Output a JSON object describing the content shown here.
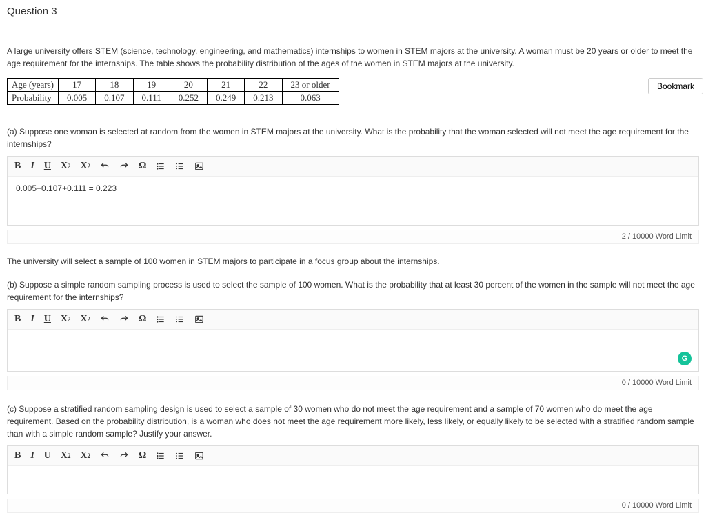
{
  "question_title": "Question 3",
  "intro": "A large university offers STEM (science, technology, engineering, and mathematics) internships to women in STEM majors at the university. A woman must be 20 years or older to meet the age requirement for the internships. The table shows the probability distribution of the ages of the women in STEM majors at the university.",
  "table": {
    "row1_label": "Age (years)",
    "row2_label": "Probability",
    "ages": [
      "17",
      "18",
      "19",
      "20",
      "21",
      "22",
      "23 or older"
    ],
    "probs": [
      "0.005",
      "0.107",
      "0.111",
      "0.252",
      "0.249",
      "0.213",
      "0.063"
    ]
  },
  "bookmark_label": "Bookmark",
  "part_a": "(a) Suppose one woman is selected at random from the women in STEM majors at the university. What is the probability that the woman selected will not meet the age requirement for the internships?",
  "answer_a": "0.005+0.107+0.111 = 0.223",
  "wordlimit_a": "2 / 10000 Word Limit",
  "mid_text": "The university will select a sample of 100 women in STEM majors to participate in a focus group about the internships.",
  "part_b": "(b) Suppose a simple random sampling process is used to select the sample of 100 women. What is the probability that at least 30 percent of the women in the sample will not meet the age requirement for the internships?",
  "answer_b": "",
  "wordlimit_b": "0 / 10000 Word Limit",
  "part_c": "(c) Suppose a stratified random sampling design is used to select a sample of 30 women who do not meet the age requirement and a sample of 70 women who do meet the age requirement. Based on the probability distribution, is a woman who does not meet the age requirement more likely, less likely, or equally likely to be selected with a stratified random sample than with a simple random sample? Justify your answer.",
  "answer_c": "",
  "wordlimit_c": "0 / 10000 Word Limit",
  "toolbar": {
    "bold": "B",
    "italic": "I",
    "underline": "U",
    "sup": "X",
    "sup2": "2",
    "sub": "X",
    "sub2": "2",
    "omega": "Ω"
  },
  "grammarly": "G"
}
